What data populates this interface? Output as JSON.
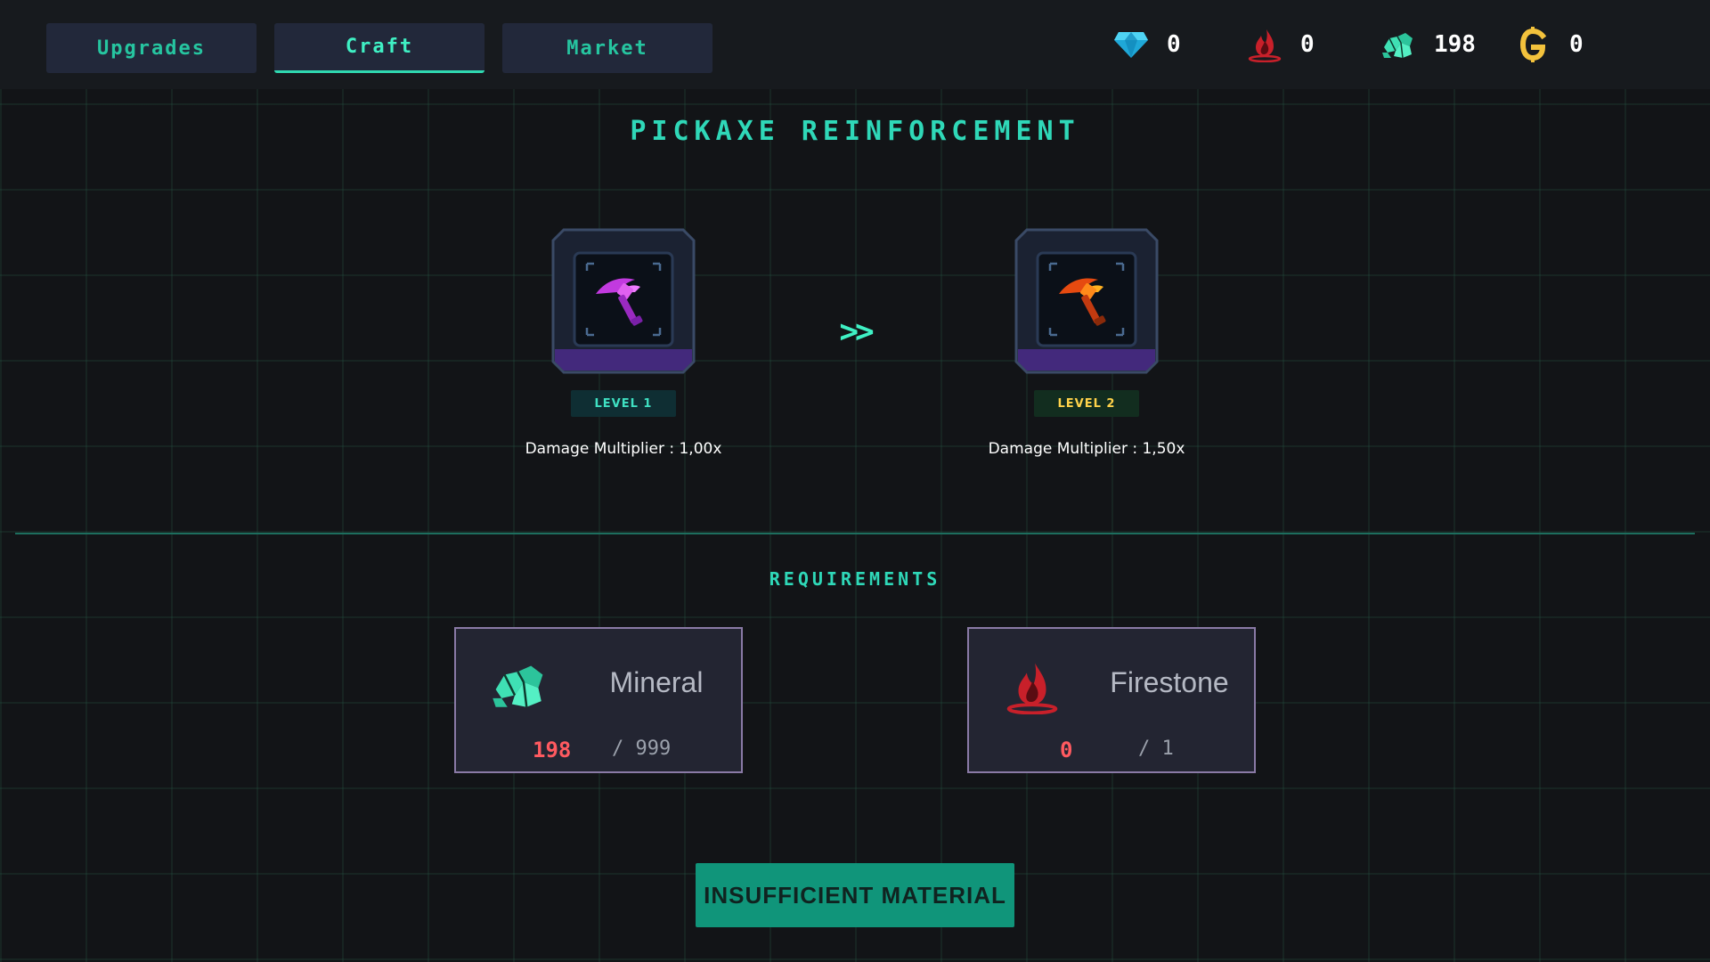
{
  "tabs": [
    {
      "label": "Upgrades",
      "active": false
    },
    {
      "label": "Craft",
      "active": true
    },
    {
      "label": "Market",
      "active": false
    }
  ],
  "currencies": {
    "diamond": {
      "icon": "diamond-icon",
      "value": "0"
    },
    "firestone": {
      "icon": "firestone-icon",
      "value": "0"
    },
    "mineral": {
      "icon": "mineral-icon",
      "value": "198"
    },
    "gold": {
      "icon": "gold-coin-icon",
      "value": "0"
    }
  },
  "title": "PICKAXE REINFORCEMENT",
  "current_item": {
    "icon": "purple-pickaxe-icon",
    "level": "LEVEL 1",
    "stat": "Damage Multiplier : 1,00x"
  },
  "arrow": ">>",
  "next_item": {
    "icon": "orange-pickaxe-icon",
    "level": "LEVEL 2",
    "stat": "Damage Multiplier : 1,50x"
  },
  "requirements": {
    "title": "REQUIREMENTS",
    "items": [
      {
        "name": "Mineral",
        "icon": "mineral-icon",
        "have": "198",
        "need": "/ 999"
      },
      {
        "name": "Firestone",
        "icon": "firestone-icon",
        "have": "0",
        "need": "/ 1"
      }
    ]
  },
  "action_button": "INSUFFICIENT MATERIAL",
  "colors": {
    "accent": "#2fd8b8",
    "insufficient": "#ff5a60",
    "button": "#10957a",
    "level2": "#ffd24a"
  }
}
